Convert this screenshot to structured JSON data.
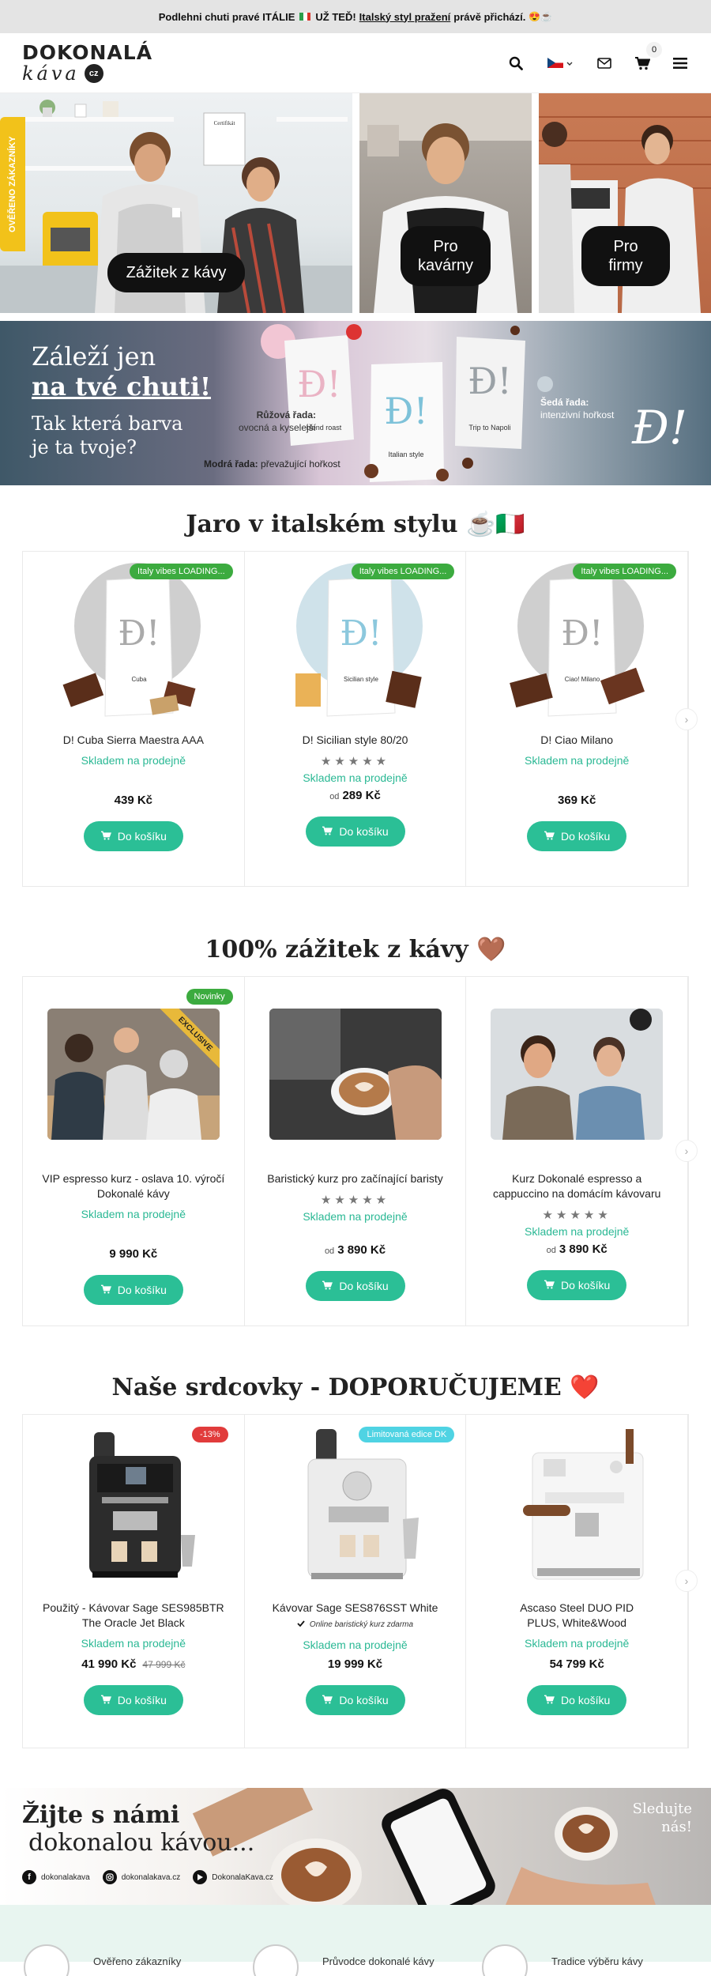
{
  "topbar": {
    "text_before": "Podlehni chuti pravé ITÁLIE",
    "text_mid": "UŽ TEĎ!",
    "link": "Italský styl pražení",
    "text_after": "právě přichází."
  },
  "header": {
    "logo_line1": "DOKONALÁ",
    "logo_line2": "káva",
    "logo_badge": "cz",
    "cart_count": "0"
  },
  "hero": {
    "side_badge": "OVĚŘENO ZÁKAZNÍKY",
    "certificate": "Certifikát",
    "panels": [
      {
        "label": "Zážitek z kávy"
      },
      {
        "label": "Pro kavárny"
      },
      {
        "label": "Pro firmy"
      }
    ]
  },
  "banner": {
    "headline1": "Záleží jen",
    "headline2": "na tvé chuti!",
    "sub1": "Tak která barva",
    "sub2": "je ta tvoje?",
    "pink_title": "Růžová řada:",
    "pink_desc1": "ovocná a kyselejší",
    "blue_title": "Modrá řada:",
    "blue_desc": "převažující hořkost",
    "grey_title": "Šedá řada:",
    "grey_desc": "intenzivní hořkost",
    "bag1_label": "blend roast",
    "bag2_label": "Italian style",
    "bag3_label": "Trip to Napoli",
    "logo_mark": "Ɖ!"
  },
  "section1": {
    "title": "Jaro v italském stylu ☕🇮🇹",
    "products": [
      {
        "tag": "Italy vibes LOADING...",
        "bag_label": "Cuba",
        "name": "D! Cuba Sierra Maestra AAA",
        "stock": "Skladem na prodejně",
        "price": "439 Kč",
        "od": "",
        "button": "Do košíku",
        "stars": ""
      },
      {
        "tag": "Italy vibes LOADING...",
        "bag_label": "Sicilian style",
        "name": "D! Sicilian style 80/20",
        "stock": "Skladem na prodejně",
        "price": "289 Kč",
        "od": "od",
        "button": "Do košíku",
        "stars": "★★★★★"
      },
      {
        "tag": "Italy vibes LOADING...",
        "bag_label": "Ciao! Milano",
        "name": "D! Ciao Milano",
        "stock": "Skladem na prodejně",
        "price": "369 Kč",
        "od": "",
        "button": "Do košíku",
        "stars": ""
      }
    ]
  },
  "section2": {
    "title": "100% zážitek z kávy 🤎",
    "products": [
      {
        "tag": "Novinky",
        "ribbon": "EXCLUSIVE",
        "name": "VIP espresso kurz - oslava 10. výročí Dokonalé kávy",
        "stock": "Skladem na prodejně",
        "price": "9 990 Kč",
        "od": "",
        "button": "Do košíku",
        "stars": ""
      },
      {
        "tag": "",
        "ribbon": "",
        "name": "Baristický kurz pro začínající baristy",
        "stock": "Skladem na prodejně",
        "price": "3 890 Kč",
        "od": "od",
        "button": "Do košíku",
        "stars": "★★★★★"
      },
      {
        "tag": "",
        "ribbon": "",
        "name": "Kurz Dokonalé espresso a cappuccino na domácím kávovaru",
        "stock": "Skladem na prodejně",
        "price": "3 890 Kč",
        "od": "od",
        "button": "Do košíku",
        "stars": "★★★★★"
      }
    ]
  },
  "section3": {
    "title": "Naše srdcovky - DOPORUČUJEME ❤️",
    "products": [
      {
        "tag": "-13%",
        "name": "Použitý - Kávovar Sage SES985BTR The Oracle Jet Black",
        "note": "",
        "stock": "Skladem na prodejně",
        "price": "41 990 Kč",
        "old_price": "47 999 Kč",
        "button": "Do košíku"
      },
      {
        "tag": "Limitovaná edice DK",
        "name": "Kávovar Sage SES876SST White",
        "note": "Online baristický kurz zdarma",
        "stock": "Skladem na prodejně",
        "price": "19 999 Kč",
        "old_price": "",
        "button": "Do košíku"
      },
      {
        "tag": "",
        "name": "Ascaso Steel DUO PID PLUS, White&Wood",
        "note": "",
        "stock": "Skladem na prodejně",
        "price": "54 799 Kč",
        "old_price": "",
        "button": "Do košíku"
      }
    ]
  },
  "footer_banner": {
    "line1": "Žijte s námi",
    "line2": "dokonalou kávou...",
    "follow1": "Sledujte",
    "follow2": "nás!",
    "social": [
      {
        "icon": "facebook-icon",
        "label": "dokonalakava"
      },
      {
        "icon": "instagram-icon",
        "label": "dokonalakava.cz"
      },
      {
        "icon": "youtube-icon",
        "label": "DokonalaKava.cz"
      }
    ]
  },
  "bottom_strip": {
    "items": [
      "Ověřeno zákazníky",
      "Průvodce dokonalé kávy",
      "Tradice výběru kávy"
    ]
  },
  "colors": {
    "accent": "#2bbf96",
    "tag_green": "#3cab3f",
    "tag_red": "#e13b3b",
    "tag_cyan": "#4fd3e3",
    "badge_yellow": "#f2c21a"
  }
}
